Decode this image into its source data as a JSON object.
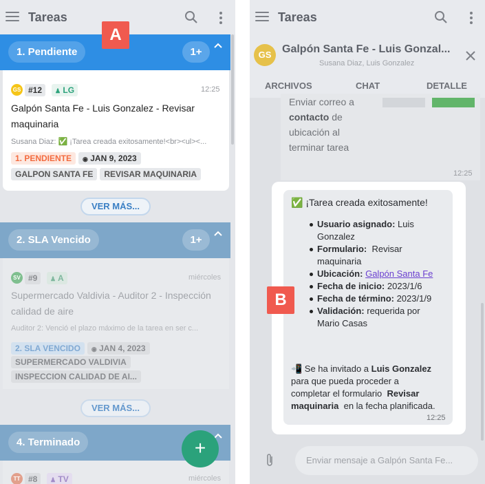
{
  "left_panel": {
    "title": "Tareas",
    "sections": [
      {
        "name": "1. Pendiente",
        "count": "1+",
        "task": {
          "avatar": "GS",
          "number": "#12",
          "assignee": "LG",
          "time": "12:25",
          "title_line1": "Galpón Santa Fe - Luis Gonzalez - Revisar",
          "title_line2": "maquinaria",
          "preview": "Susana Diaz: ✅ ¡Tarea creada exitosamente!<br><ul><...",
          "status_tag": "1. PENDIENTE",
          "date_tag": "JAN 9, 2023",
          "tags": [
            "GALPON SANTA FE",
            "REVISAR MAQUINARIA"
          ]
        },
        "more_button": "VER MÁS..."
      },
      {
        "name": "2. SLA Vencido",
        "count": "1+",
        "task": {
          "avatar": "SV",
          "number": "#9",
          "assignee": "A",
          "time": "miércoles",
          "title_line1": "Supermercado Valdivia - Auditor 2 - Inspección",
          "title_line2": "calidad de aire",
          "preview": "Auditor 2: Venció el plazo máximo de la tarea en ser c...",
          "status_tag": "2. SLA VENCIDO",
          "date_tag": "JAN 4, 2023",
          "tags": [
            "SUPERMERCADO VALDIVIA",
            "INSPECCION CALIDAD DE AI..."
          ]
        },
        "more_button": "VER MÁS..."
      },
      {
        "name": "4. Terminado",
        "task": {
          "avatar": "TT",
          "number": "#8",
          "assignee": "TV",
          "time": "miércoles"
        }
      }
    ],
    "fab_label": "+",
    "marker": "A"
  },
  "right_panel": {
    "title": "Tareas",
    "chat_avatar": "GS",
    "chat_title": "Galpón Santa Fe - Luis Gonzal...",
    "chat_subtitle": "Susana Diaz, Luis Gonzalez",
    "tabs": [
      "ARCHIVOS",
      "CHAT",
      "DETALLE"
    ],
    "active_tab": "CHAT",
    "prev_message": {
      "line1": "Enviar correo a",
      "line2_bold": "contacto",
      "line2_rest": " de",
      "line3": "ubicación al",
      "line4": "terminar tarea",
      "time": "12:25"
    },
    "message": {
      "heading": "✅ ¡Tarea creada exitosamente!",
      "items": [
        {
          "label": "Usuario asignado:",
          "value": " Luis",
          "cont": "Gonzalez"
        },
        {
          "label": "Formulario:",
          "value": "  Revisar",
          "cont": "maquinaria"
        },
        {
          "label": "Ubicación:",
          "value": "Galpón Santa Fe",
          "link": true
        },
        {
          "label": "Fecha de inicio:",
          "value": " 2023/1/6"
        },
        {
          "label": "Fecha de término:",
          "value": " 2023/1/9"
        },
        {
          "label": "Validación:",
          "value": " requerida por",
          "cont": "Mario Casas"
        }
      ],
      "invite_l1a": "📲 Se ha invitado a ",
      "invite_l1b": "Luis Gonzalez",
      "invite_l2": "para que pueda proceder a",
      "invite_l3a": "completar el formulario  ",
      "invite_l3b": "Revisar",
      "invite_l4a": "maquinaria",
      "invite_l4b": "  en la fecha planificada.",
      "time": "12:25"
    },
    "input_placeholder": "Enviar mensaje a Galpón Santa Fe...",
    "marker": "B"
  },
  "colors": {
    "accent": "#2e8ee4",
    "fab": "#2ba27b",
    "marker": "#f05a4f",
    "status_pending": "#f36b3f"
  }
}
